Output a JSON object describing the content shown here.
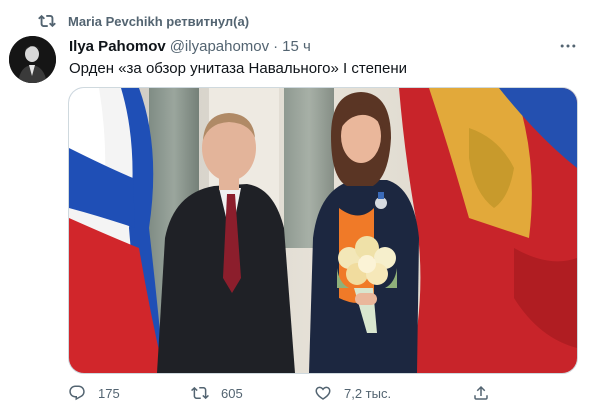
{
  "retweet": {
    "icon": "retweet-icon",
    "text": "Maria Pevchikh ретвитнул(а)"
  },
  "tweet": {
    "author": {
      "display_name": "Ilya Pahomov",
      "handle": "@ilyapahomov",
      "avatar": "avatar"
    },
    "separator": "·",
    "time": "15 ч",
    "text": "Орден «за обзор унитаза Навального» I степени",
    "media": {
      "type": "photo"
    }
  },
  "actions": {
    "reply_count": "175",
    "retweet_count": "605",
    "like_count": "7,2 тыс.",
    "icons": [
      "reply-icon",
      "retweet-icon",
      "like-icon",
      "share-icon"
    ]
  },
  "colors": {
    "secondary_text": "#536471",
    "primary_text": "#0f1419",
    "border": "#cfd9de"
  }
}
